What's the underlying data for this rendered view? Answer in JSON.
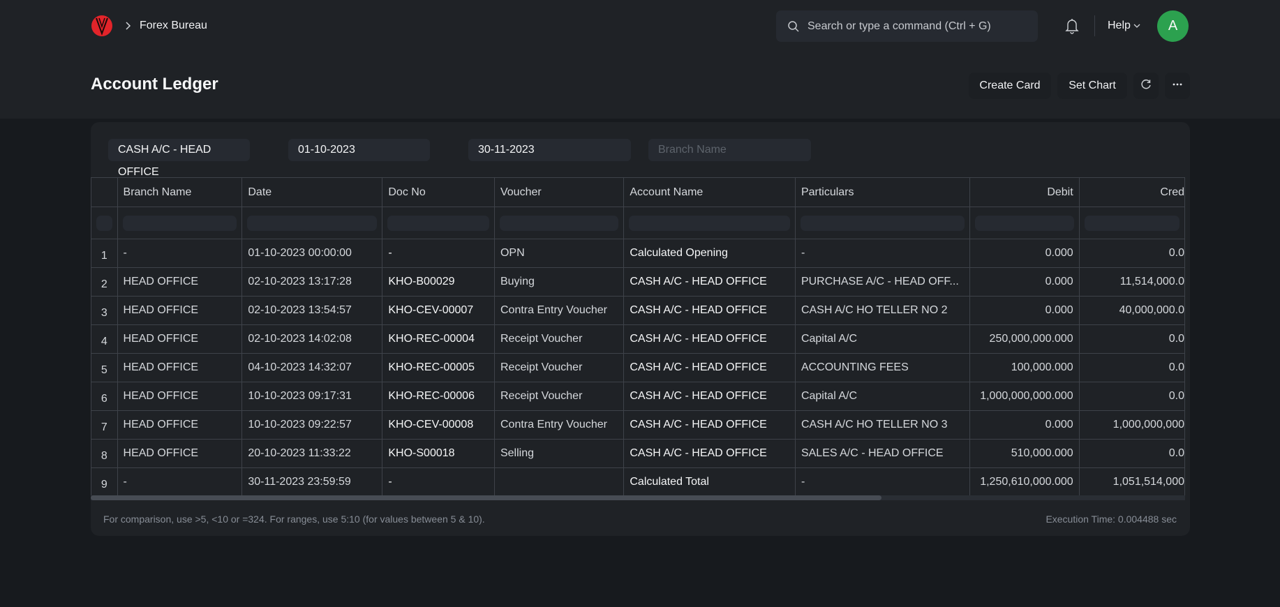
{
  "navbar": {
    "logo": "brand-logo",
    "breadcrumb": [
      "Forex Bureau"
    ],
    "search_placeholder": "Search or type a command (Ctrl + G)",
    "help_label": "Help",
    "avatar_initial": "A",
    "avatar_color": "#2ca14f"
  },
  "page": {
    "title": "Account Ledger",
    "buttons": {
      "create_card": "Create Card",
      "set_chart": "Set Chart",
      "refresh": "refresh-icon",
      "more": "more-icon"
    }
  },
  "filters": {
    "account": "CASH A/C - HEAD OFFICE",
    "from_date": "01-10-2023",
    "to_date": "30-11-2023",
    "branch_placeholder": "Branch Name"
  },
  "table": {
    "columns": [
      "Branch Name",
      "Date",
      "Doc No",
      "Voucher",
      "Account Name",
      "Particulars",
      "Debit",
      "Cred"
    ],
    "rows": [
      {
        "no": "1",
        "branch": "-",
        "date": "01-10-2023 00:00:00",
        "doc": "-",
        "voucher": "OPN",
        "account": "Calculated Opening",
        "particulars": "-",
        "debit": "0.000",
        "credit": "0.0"
      },
      {
        "no": "2",
        "branch": "HEAD OFFICE",
        "date": "02-10-2023 13:17:28",
        "doc": "KHO-B00029",
        "voucher": "Buying",
        "account": "CASH A/C - HEAD OFFICE",
        "particulars": "PURCHASE A/C - HEAD OFF...",
        "debit": "0.000",
        "credit": "11,514,000.0"
      },
      {
        "no": "3",
        "branch": "HEAD OFFICE",
        "date": "02-10-2023 13:54:57",
        "doc": "KHO-CEV-00007",
        "voucher": "Contra Entry Voucher",
        "account": "CASH A/C - HEAD OFFICE",
        "particulars": "CASH A/C HO TELLER NO 2",
        "debit": "0.000",
        "credit": "40,000,000.0"
      },
      {
        "no": "4",
        "branch": "HEAD OFFICE",
        "date": "02-10-2023 14:02:08",
        "doc": "KHO-REC-00004",
        "voucher": "Receipt Voucher",
        "account": "CASH A/C - HEAD OFFICE",
        "particulars": "Capital A/C",
        "debit": "250,000,000.000",
        "credit": "0.0"
      },
      {
        "no": "5",
        "branch": "HEAD OFFICE",
        "date": "04-10-2023 14:32:07",
        "doc": "KHO-REC-00005",
        "voucher": "Receipt Voucher",
        "account": "CASH A/C - HEAD OFFICE",
        "particulars": "ACCOUNTING FEES",
        "debit": "100,000.000",
        "credit": "0.0"
      },
      {
        "no": "6",
        "branch": "HEAD OFFICE",
        "date": "10-10-2023 09:17:31",
        "doc": "KHO-REC-00006",
        "voucher": "Receipt Voucher",
        "account": "CASH A/C - HEAD OFFICE",
        "particulars": "Capital A/C",
        "debit": "1,000,000,000.000",
        "credit": "0.0"
      },
      {
        "no": "7",
        "branch": "HEAD OFFICE",
        "date": "10-10-2023 09:22:57",
        "doc": "KHO-CEV-00008",
        "voucher": "Contra Entry Voucher",
        "account": "CASH A/C - HEAD OFFICE",
        "particulars": "CASH A/C HO TELLER NO 3",
        "debit": "0.000",
        "credit": "1,000,000,000"
      },
      {
        "no": "8",
        "branch": "HEAD OFFICE",
        "date": "20-10-2023 11:33:22",
        "doc": "KHO-S00018",
        "voucher": "Selling",
        "account": "CASH A/C - HEAD OFFICE",
        "particulars": "SALES A/C - HEAD OFFICE",
        "debit": "510,000.000",
        "credit": "0.0"
      },
      {
        "no": "9",
        "branch": "-",
        "date": "30-11-2023 23:59:59",
        "doc": "-",
        "voucher": "",
        "account": "Calculated Total",
        "particulars": "-",
        "debit": "1,250,610,000.000",
        "credit": "1,051,514,000"
      }
    ]
  },
  "footer": {
    "hint": "For comparison, use >5, <10 or =324. For ranges, use 5:10 (for values between 5 & 10).",
    "execution_time": "Execution Time: 0.004488 sec"
  }
}
